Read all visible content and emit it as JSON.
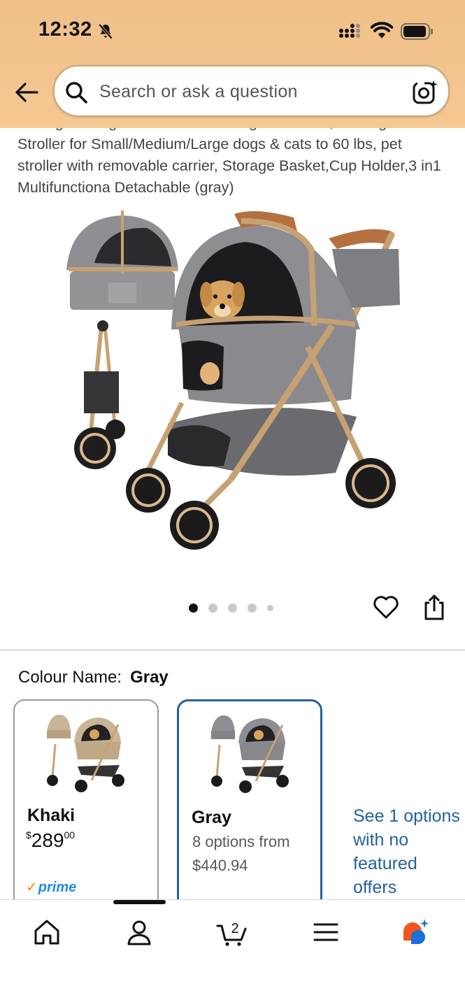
{
  "status_bar": {
    "time": "12:32"
  },
  "search": {
    "placeholder": "Search or ask a question"
  },
  "product": {
    "title": "Rolling Carriage Pet Stroller for Dogs and Cats, Folding Pet Stroller for Small/Medium/Large dogs & cats to 60 lbs, pet stroller with removable carrier, Storage Basket,Cup Holder,3 in1 Multifunctiona Detachable (gray)",
    "image_count": 5,
    "active_image": 1
  },
  "colour": {
    "label": "Colour Name:",
    "selected": "Gray",
    "options": [
      {
        "name": "Khaki",
        "price_whole": "289",
        "price_fraction": "00",
        "currency": "$",
        "prime": "prime"
      },
      {
        "name": "Gray",
        "offers_line": "8 options from",
        "price": "$440.94"
      }
    ],
    "more_offers": "See 1 options with no featured offers"
  },
  "more_offers_lines": [
    "See 1 options",
    "with no",
    "featured",
    "offers"
  ],
  "cart": {
    "count": "2"
  },
  "colors": {
    "header": "#f3c48f",
    "link": "#2162a1",
    "selected_border": "#2162a1",
    "prime_blue": "#1f8ce6",
    "prime_check": "#f08804"
  },
  "nav": [
    "home-icon",
    "account-icon",
    "cart-icon",
    "menu-icon",
    "rufus-icon"
  ]
}
